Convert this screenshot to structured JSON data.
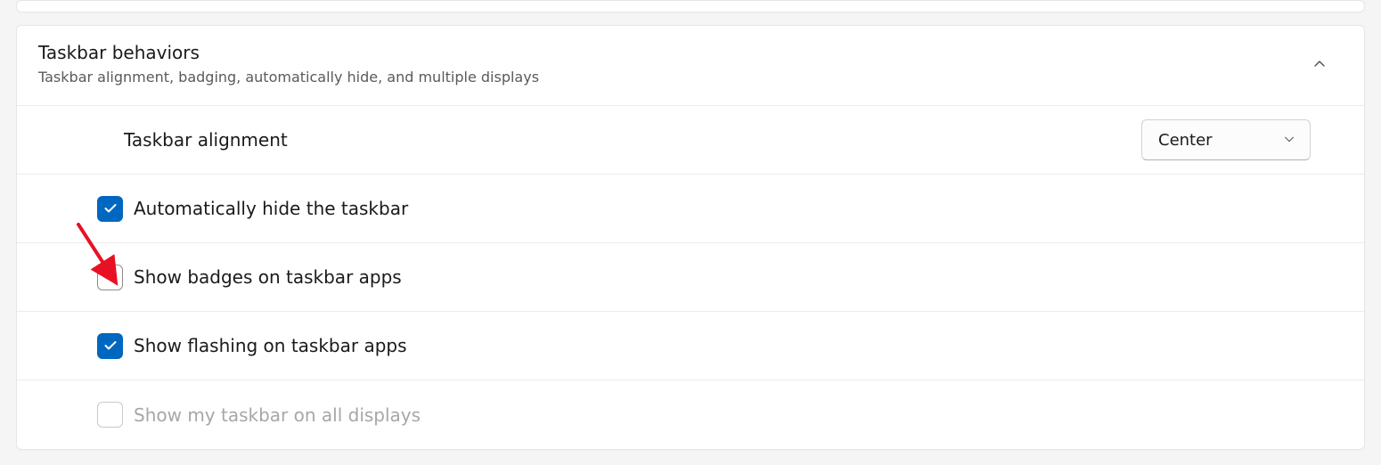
{
  "section": {
    "title": "Taskbar behaviors",
    "subtitle": "Taskbar alignment, badging, automatically hide, and multiple displays"
  },
  "alignment": {
    "label": "Taskbar alignment",
    "value": "Center"
  },
  "options": {
    "auto_hide": {
      "label": "Automatically hide the taskbar",
      "checked": true,
      "disabled": false
    },
    "badges": {
      "label": "Show badges on taskbar apps",
      "checked": false,
      "disabled": false
    },
    "flashing": {
      "label": "Show flashing on taskbar apps",
      "checked": true,
      "disabled": false
    },
    "all_disp": {
      "label": "Show my taskbar on all displays",
      "checked": false,
      "disabled": true
    }
  }
}
